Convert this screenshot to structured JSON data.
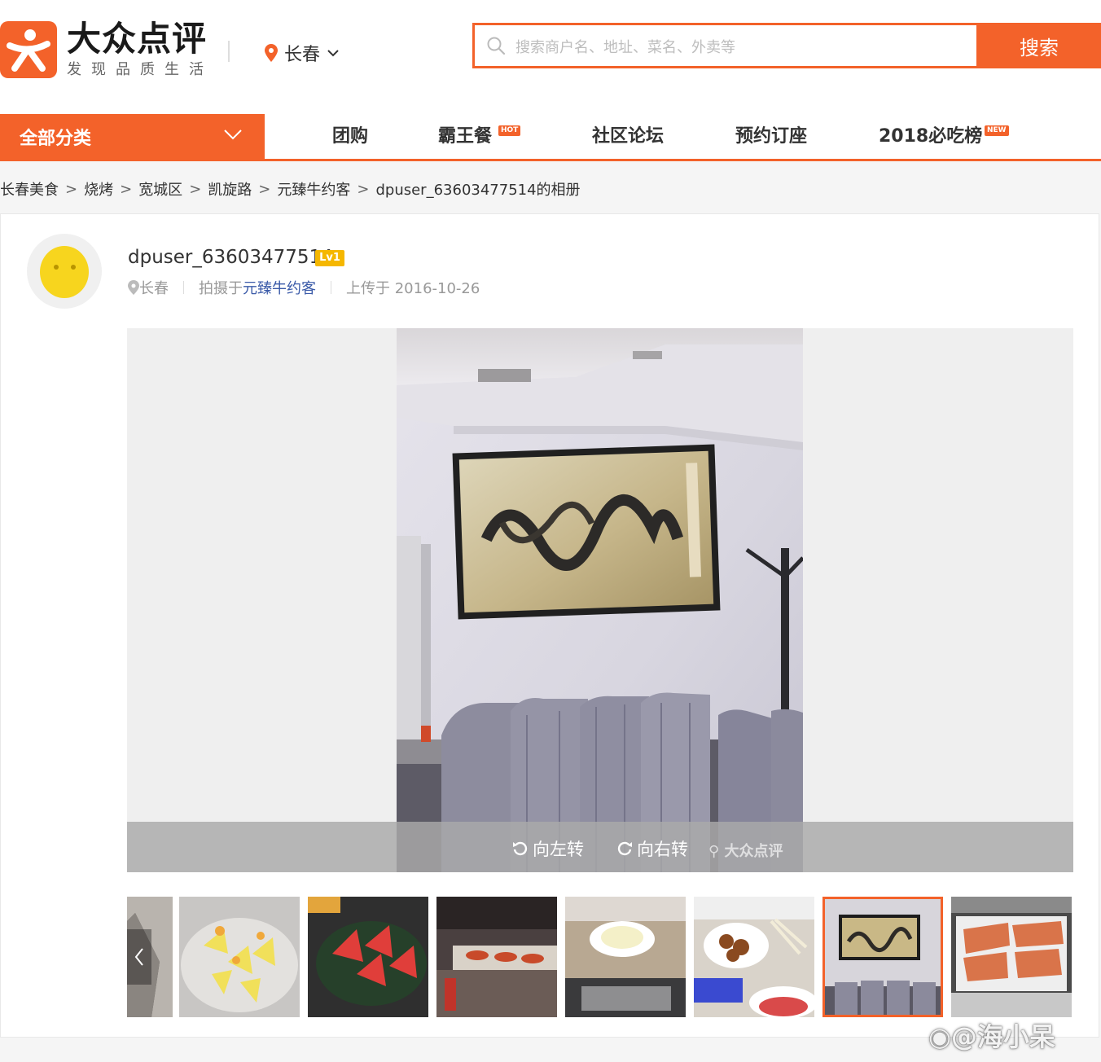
{
  "header": {
    "logo_title": "大众点评",
    "logo_subtitle": "发现品质生活",
    "city": "长春",
    "search_placeholder": "搜索商户名、地址、菜名、外卖等",
    "search_button": "搜索"
  },
  "nav": {
    "all_categories": "全部分类",
    "items": [
      {
        "label": "团购",
        "badge": ""
      },
      {
        "label": "霸王餐",
        "badge": "HOT"
      },
      {
        "label": "社区论坛",
        "badge": ""
      },
      {
        "label": "预约订座",
        "badge": ""
      },
      {
        "label": "2018必吃榜",
        "badge": "NEW"
      }
    ]
  },
  "breadcrumb": [
    "长春美食",
    "烧烤",
    "宽城区",
    "凯旋路",
    "元臻牛约客",
    "dpuser_63603477514的相册"
  ],
  "breadcrumb_separator": ">",
  "user": {
    "name": "dpuser_63603477514",
    "level": "Lv1",
    "city": "长春",
    "shot_at_label": "拍摄于",
    "shop": "元臻牛约客",
    "uploaded": "上传于 2016-10-26"
  },
  "viewer": {
    "rotate_left": "向左转",
    "rotate_right": "向右转",
    "watermark": "大众点评"
  },
  "thumbnails": [
    "tray-foil",
    "lemon-slices",
    "watermelon-plate",
    "buffet-counter",
    "ice-cream-bowl",
    "bbq-plates",
    "calligraphy-wall",
    "grill-meat"
  ],
  "active_thumbnail": 6,
  "weibo_watermark": "@海小呆",
  "colors": {
    "brand": "#f3622a",
    "level_badge": "#f5b700",
    "link": "#3a5aa8"
  }
}
